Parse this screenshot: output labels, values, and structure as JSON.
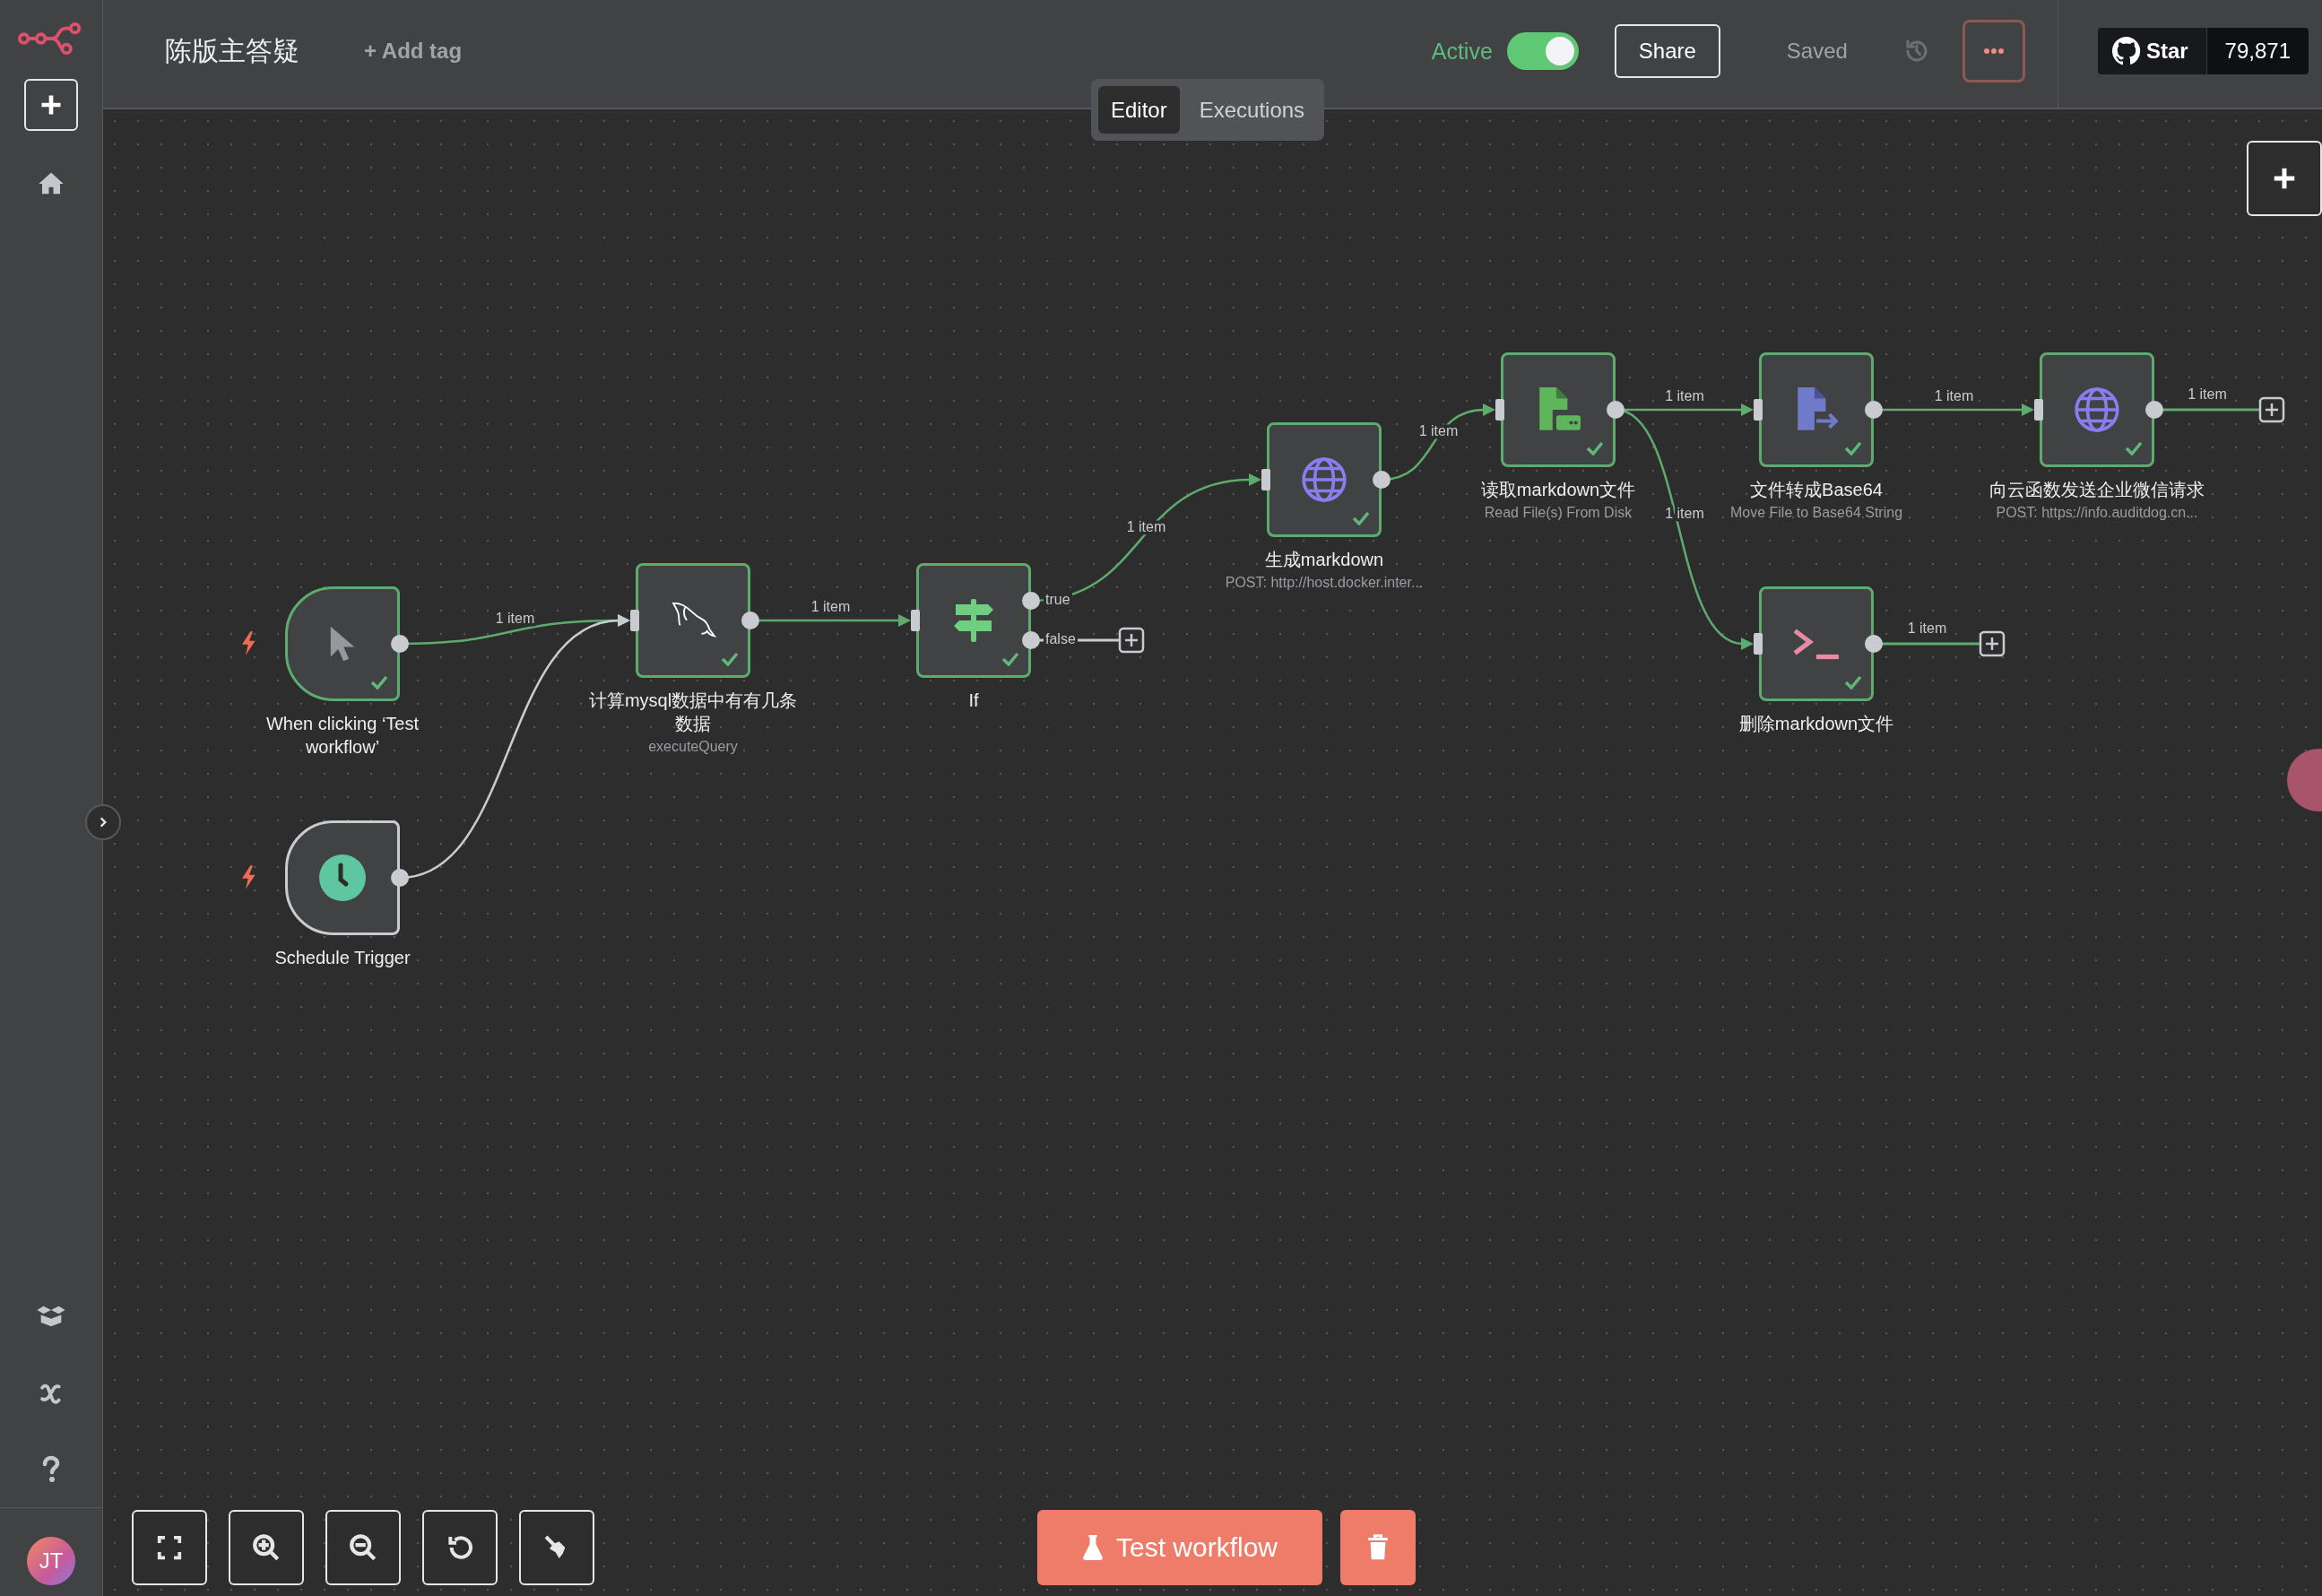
{
  "header": {
    "title": "陈版主答疑",
    "add_tag": "+ Add tag",
    "active_label": "Active",
    "active": true,
    "share": "Share",
    "save_status": "Saved",
    "github": {
      "star": "Star",
      "count": "79,871"
    }
  },
  "view_tabs": [
    {
      "label": "Editor",
      "selected": true
    },
    {
      "label": "Executions",
      "selected": false
    }
  ],
  "sidebar": {
    "avatar_initials": "JT"
  },
  "nodes": [
    {
      "name": "When clicking ‘Test workflow’",
      "kind": "manual-trigger",
      "executed": true
    },
    {
      "name": "Schedule Trigger",
      "kind": "schedule-trigger",
      "executed": false
    },
    {
      "name": "计算mysql数据中有有几条数据",
      "subtitle": "executeQuery",
      "kind": "mysql",
      "executed": true
    },
    {
      "name": "If",
      "kind": "if",
      "executed": true,
      "outputs": [
        "true",
        "false"
      ]
    },
    {
      "name": "生成markdown",
      "subtitle": "POST: http://host.docker.inter...",
      "kind": "http",
      "executed": true
    },
    {
      "name": "读取markdown文件",
      "subtitle": "Read File(s) From Disk",
      "kind": "read-file",
      "executed": true
    },
    {
      "name": "文件转成Base64",
      "subtitle": "Move File to Base64 String",
      "kind": "move-binary",
      "executed": true
    },
    {
      "name": "向云函数发送企业微信请求",
      "subtitle": "POST: https://info.auditdog.cn...",
      "kind": "http",
      "executed": true
    },
    {
      "name": "删除markdown文件",
      "kind": "command",
      "executed": true
    }
  ],
  "connections": [
    {
      "label": "1 item",
      "active": true
    },
    {
      "active": false
    },
    {
      "label": "1 item",
      "active": true
    },
    {
      "label": "1 item",
      "active": true
    },
    {
      "active": false
    },
    {
      "label": "1 item",
      "active": true
    },
    {
      "label": "1 item",
      "active": true
    },
    {
      "label": "1 item",
      "active": true
    },
    {
      "label": "1 item",
      "active": true
    },
    {
      "label": "1 item",
      "active": true
    },
    {
      "label": "1 item",
      "active": true
    }
  ],
  "actions": {
    "test_workflow": "Test workflow"
  }
}
